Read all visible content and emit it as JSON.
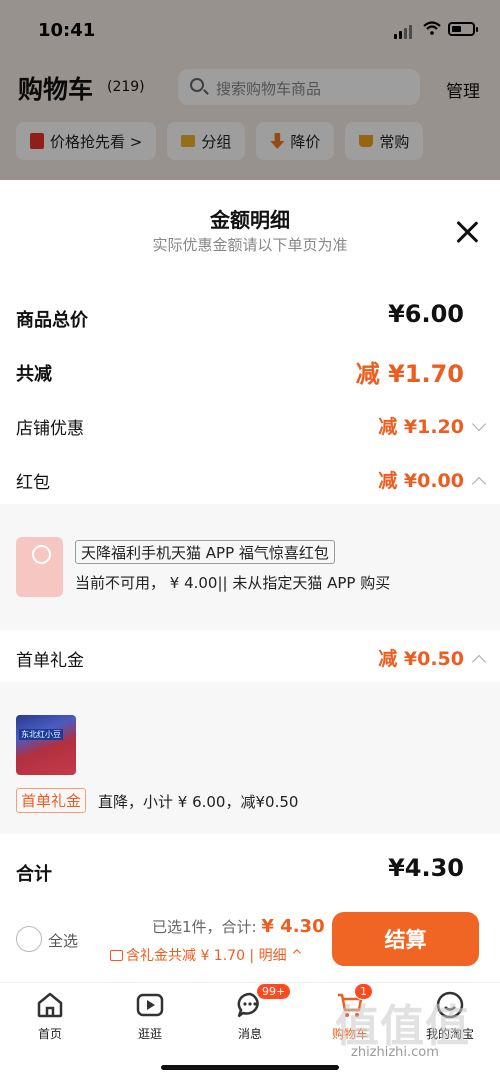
{
  "status_bar": {
    "time": "10:41"
  },
  "header": {
    "title": "购物车",
    "count": "(219)",
    "search_placeholder": "搜索购物车商品",
    "manage": "管理"
  },
  "chips": [
    {
      "label": "价格抢先看 >"
    },
    {
      "label": "分组"
    },
    {
      "label": "降价"
    },
    {
      "label": "常购"
    }
  ],
  "sheet": {
    "title": "金额明细",
    "subtitle": "实际优惠金额请以下单页为准",
    "rows": {
      "total_price": {
        "label": "商品总价",
        "value": "¥6.00"
      },
      "total_reduce": {
        "label": "共减",
        "value": "减 ¥1.70"
      },
      "shop_discount": {
        "label": "店铺优惠",
        "value": "减 ¥1.20"
      },
      "red_packet": {
        "label": "红包",
        "value": "减 ¥0.00"
      },
      "first_order": {
        "label": "首单礼金",
        "value": "减 ¥0.50"
      },
      "sum": {
        "label": "合计",
        "value": "¥4.30"
      }
    },
    "red_packet_detail": {
      "tag": "天降福利手机天猫 APP 福气惊喜红包",
      "note": "当前不可用， ¥ 4.00|| 未从指定天猫 APP 购买"
    },
    "gift_detail": {
      "product_label": "东北红小豆",
      "tag": "首单礼金",
      "note": "直降，小计 ¥ 6.00，减¥0.50"
    }
  },
  "footer": {
    "select_all": "全选",
    "selected_prefix": "已选1件，合计:",
    "selected_price": "¥ 4.30",
    "discount_line": "含礼金共减 ¥ 1.70 | 明细 ^",
    "checkout": "结算"
  },
  "tabbar": {
    "tabs": [
      {
        "label": "首页"
      },
      {
        "label": "逛逛"
      },
      {
        "label": "消息",
        "badge": "99+"
      },
      {
        "label": "购物车",
        "badge": "1"
      },
      {
        "label": "我的淘宝"
      }
    ]
  },
  "watermark": {
    "text": "值值值",
    "url": "zhizhizhi.com"
  },
  "colors": {
    "accent": "#ee5d20",
    "button": "#f06523",
    "badge": "#ff4a1f"
  }
}
